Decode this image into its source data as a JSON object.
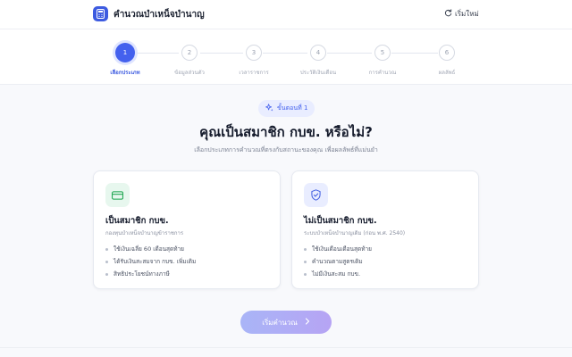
{
  "header": {
    "app_title": "คำนวณบำเหน็จบำนาญ",
    "restart_label": "เริ่มใหม่",
    "logo_icon": "calculator-icon",
    "restart_icon": "refresh-icon"
  },
  "stepper": {
    "active_step": 1,
    "steps": [
      {
        "number": "1",
        "label": "เลือกประเภท"
      },
      {
        "number": "2",
        "label": "ข้อมูลส่วนตัว"
      },
      {
        "number": "3",
        "label": "เวลาราชการ"
      },
      {
        "number": "4",
        "label": "ประวัติเงินเดือน"
      },
      {
        "number": "5",
        "label": "การคำนวณ"
      },
      {
        "number": "6",
        "label": "ผลลัพธ์"
      }
    ]
  },
  "main": {
    "badge_label": "ขั้นตอนที่ 1",
    "badge_icon": "sparkle-icon",
    "title": "คุณเป็นสมาชิก กบข. หรือไม่?",
    "subtitle": "เลือกประเภทการคำนวณที่ตรงกับสถานะของคุณ เพื่อผลลัพธ์ที่แม่นยำ"
  },
  "cards": [
    {
      "title": "เป็นสมาชิก กบข.",
      "description": "กองทุนบำเหน็จบำนาญข้าราชการ",
      "icon": "credit-card-icon",
      "icon_color": "#16a34a",
      "icon_bg": "#e7f7ee",
      "bullets": [
        "ใช้เงินเฉลี่ย 60 เดือนสุดท้าย",
        "ได้รับเงินสะสมจาก กบข. เพิ่มเติม",
        "สิทธิประโยชน์ทางภาษี"
      ]
    },
    {
      "title": "ไม่เป็นสมาชิก กบข.",
      "description": "ระบบบำเหน็จบำนาญเดิม (ก่อน พ.ศ. 2540)",
      "icon": "shield-check-icon",
      "icon_color": "#3d5be0",
      "icon_bg": "#e9edff",
      "bullets": [
        "ใช้เงินเดือนเดือนสุดท้าย",
        "คำนวณตามสูตรเดิม",
        "ไม่มีเงินสะสม กบข."
      ]
    }
  ],
  "start_button": {
    "label": "เริ่มคำนวณ",
    "icon": "chevron-right-icon"
  },
  "colors": {
    "accent": "#4461ee",
    "accent_light": "#e9edff"
  }
}
